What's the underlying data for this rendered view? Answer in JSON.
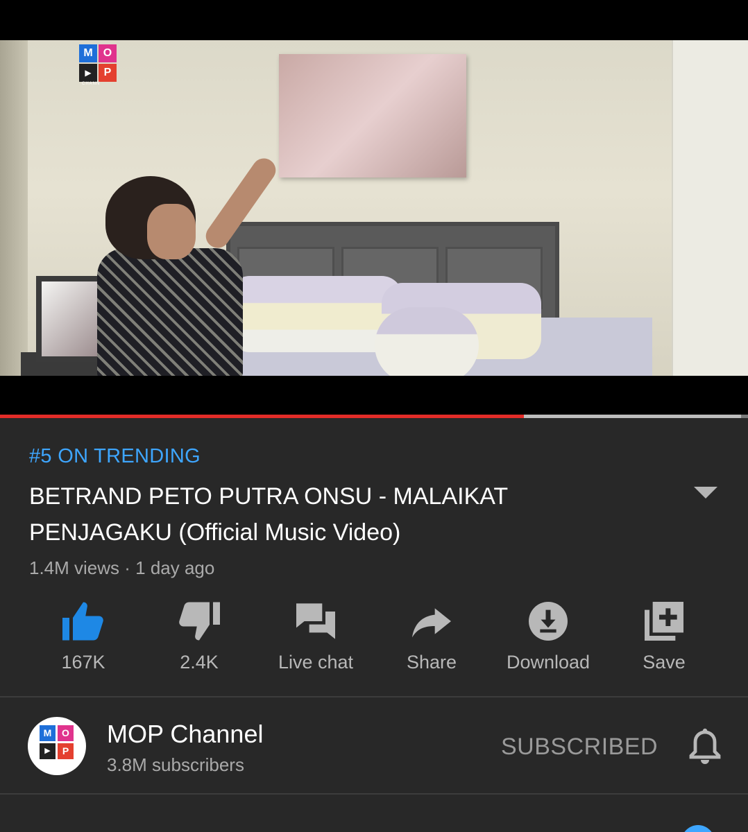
{
  "player": {
    "watermark": {
      "letters": [
        "M",
        "O",
        "▶",
        "P"
      ],
      "caption": "CHANN"
    },
    "progress": {
      "played_fraction": 0.7,
      "buffered_fraction": 0.99
    },
    "colors": {
      "played": "#e32c28",
      "buffered": "#bdbdbd",
      "track": "#7a7a7a"
    }
  },
  "video": {
    "trending": "#5 ON TRENDING",
    "title": "BETRAND PETO PUTRA ONSU - MALAIKAT PENJAGAKU (Official Music Video)",
    "meta": "1.4M views · 1 day ago"
  },
  "actions": [
    {
      "icon": "thumbs-up-icon",
      "label": "167K",
      "active": true
    },
    {
      "icon": "thumbs-down-icon",
      "label": "2.4K"
    },
    {
      "icon": "live-chat-icon",
      "label": "Live chat"
    },
    {
      "icon": "share-icon",
      "label": "Share"
    },
    {
      "icon": "download-icon",
      "label": "Download"
    },
    {
      "icon": "save-playlist-icon",
      "label": "Save"
    }
  ],
  "channel": {
    "name": "MOP Channel",
    "subscribers": "3.8M subscribers",
    "subscribe_label": "SUBSCRIBED",
    "avatar_letters": [
      "M",
      "O",
      "▶",
      "P"
    ]
  },
  "colors": {
    "accent": "#3ea6ff",
    "background": "#282828",
    "logo_blue": "#1e6fd9",
    "logo_pink": "#e0338d",
    "logo_dark": "#222222",
    "logo_red": "#e4402f"
  }
}
